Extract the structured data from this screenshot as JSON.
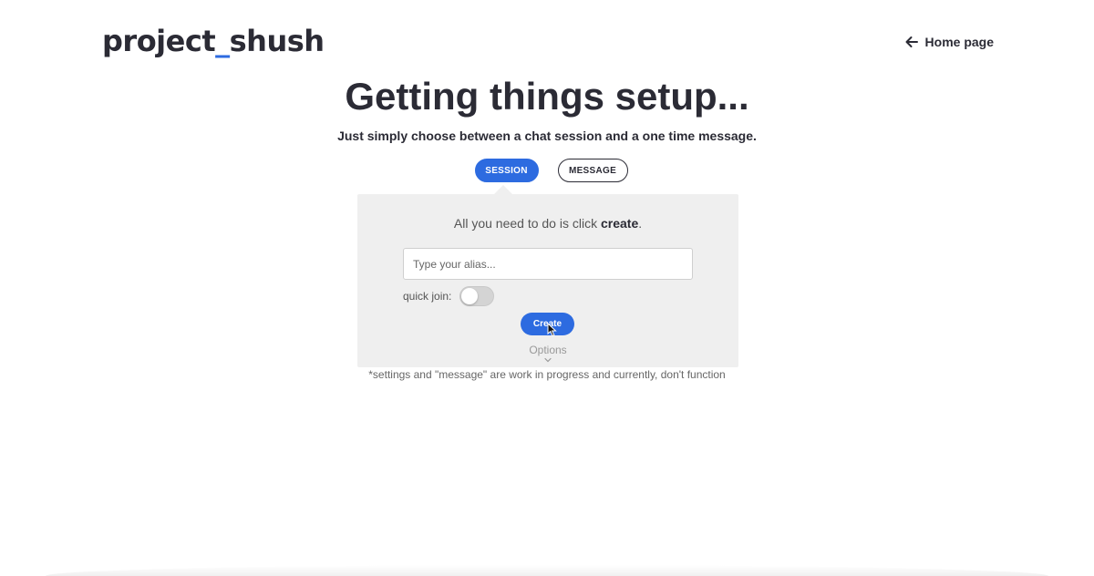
{
  "header": {
    "logo": {
      "part1": "project",
      "separator": "_",
      "part2": "shush"
    },
    "home_link": "Home page"
  },
  "main": {
    "title": "Getting things setup...",
    "subtitle": "Just simply choose between a chat session and a one time message.",
    "tabs": [
      {
        "label": "SESSION",
        "active": true
      },
      {
        "label": "MESSAGE",
        "active": false
      }
    ]
  },
  "panel": {
    "intro_prefix": "All you need to do is click ",
    "intro_bold": "create",
    "intro_suffix": ".",
    "alias_placeholder": "Type your alias...",
    "alias_value": "",
    "quick_join_label": "quick join:",
    "quick_join_on": false,
    "create_label": "Create",
    "options_label": "Options"
  },
  "footnote": "*settings and \"message\" are work in progress and currently, don't function",
  "icons": {
    "home_link": "arrow-left-icon",
    "options": "chevron-down-icon",
    "pointer": "hand-cursor-icon"
  },
  "colors": {
    "accent": "#2d6be0",
    "text": "#2b2b35",
    "panel_bg": "#efefef"
  }
}
